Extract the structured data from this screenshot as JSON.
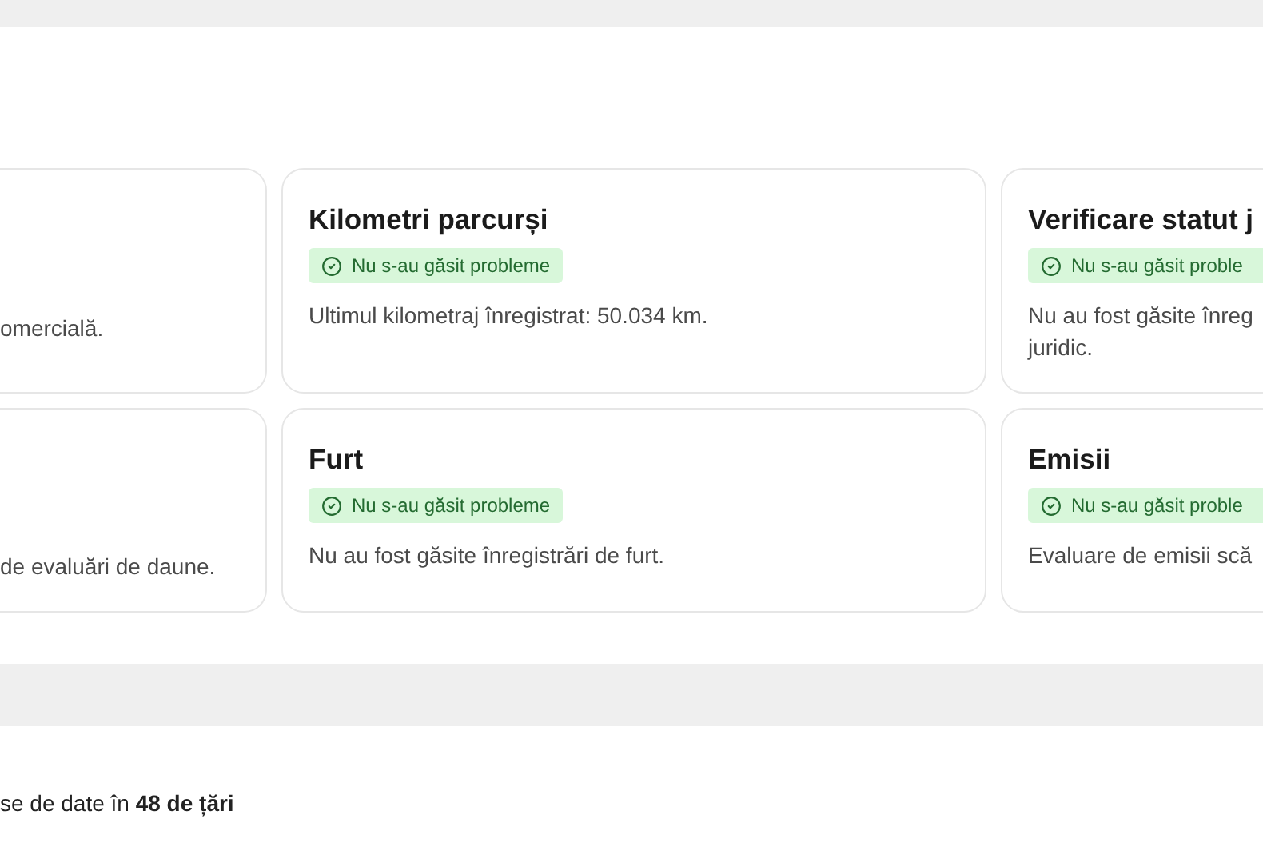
{
  "cards": [
    {
      "description": "omercială."
    },
    {
      "title": "Kilometri parcurși",
      "badge": "Nu s-au găsit probleme",
      "description": "Ultimul kilometraj înregistrat: 50.034 km."
    },
    {
      "title": "Verificare statut j",
      "badge": "Nu s-au găsit proble",
      "description": "Nu au fost găsite înreg\njuridic."
    },
    {
      "description": "de evaluări de daune."
    },
    {
      "title": "Furt",
      "badge": "Nu s-au găsit probleme",
      "description": "Nu au fost găsite înregistrări de furt."
    },
    {
      "title": "Emisii",
      "badge": "Nu s-au găsit proble",
      "description": "Evaluare de emisii scă"
    }
  ],
  "footer_text": "se de date în **48 de țări**"
}
